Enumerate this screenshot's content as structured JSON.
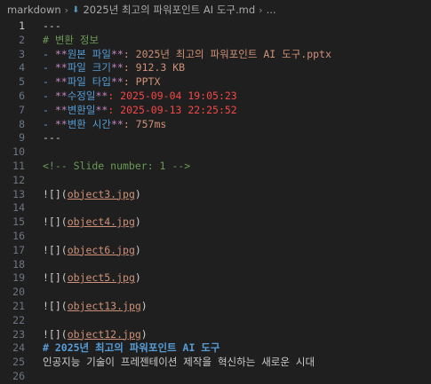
{
  "breadcrumb": {
    "folder": "markdown",
    "file": "2025년 최고의 파워포인트 AI 도구.md",
    "tail": "..."
  },
  "lines": [
    {
      "n": "1",
      "parts": [
        {
          "t": "---",
          "c": "c-default"
        }
      ]
    },
    {
      "n": "2",
      "parts": [
        {
          "t": "# 변환 정보",
          "c": "c-comment"
        }
      ]
    },
    {
      "n": "3",
      "parts": [
        {
          "t": "- ",
          "c": "c-bullet"
        },
        {
          "t": "**",
          "c": "c-bold"
        },
        {
          "t": "원본 파일",
          "c": "c-key"
        },
        {
          "t": "**",
          "c": "c-bold"
        },
        {
          "t": ": 2025년 최고의 파워포인트 AI 도구.pptx",
          "c": "c-val"
        }
      ]
    },
    {
      "n": "4",
      "parts": [
        {
          "t": "- ",
          "c": "c-bullet"
        },
        {
          "t": "**",
          "c": "c-bold"
        },
        {
          "t": "파일 크기",
          "c": "c-key"
        },
        {
          "t": "**",
          "c": "c-bold"
        },
        {
          "t": ": 912.3 KB",
          "c": "c-val"
        }
      ]
    },
    {
      "n": "5",
      "parts": [
        {
          "t": "- ",
          "c": "c-bullet"
        },
        {
          "t": "**",
          "c": "c-bold"
        },
        {
          "t": "파일 타입",
          "c": "c-key"
        },
        {
          "t": "**",
          "c": "c-bold"
        },
        {
          "t": ": PPTX",
          "c": "c-val"
        }
      ]
    },
    {
      "n": "6",
      "parts": [
        {
          "t": "- ",
          "c": "c-bullet"
        },
        {
          "t": "**",
          "c": "c-bold"
        },
        {
          "t": "수정일",
          "c": "c-key"
        },
        {
          "t": "**",
          "c": "c-bold"
        },
        {
          "t": ": 2025-09-04 19:05:23",
          "c": "c-red"
        }
      ]
    },
    {
      "n": "7",
      "parts": [
        {
          "t": "- ",
          "c": "c-bullet"
        },
        {
          "t": "**",
          "c": "c-bold"
        },
        {
          "t": "변환일",
          "c": "c-key"
        },
        {
          "t": "**",
          "c": "c-bold"
        },
        {
          "t": ": 2025-09-13 22:25:52",
          "c": "c-red"
        }
      ]
    },
    {
      "n": "8",
      "parts": [
        {
          "t": "- ",
          "c": "c-bullet"
        },
        {
          "t": "**",
          "c": "c-bold"
        },
        {
          "t": "변환 시간",
          "c": "c-key"
        },
        {
          "t": "**",
          "c": "c-bold"
        },
        {
          "t": ": 757ms",
          "c": "c-val"
        }
      ]
    },
    {
      "n": "9",
      "parts": [
        {
          "t": "---",
          "c": "c-default"
        }
      ]
    },
    {
      "n": "10",
      "parts": []
    },
    {
      "n": "11",
      "parts": [
        {
          "t": "<!-- Slide number: 1 -->",
          "c": "c-comment"
        }
      ]
    },
    {
      "n": "12",
      "parts": []
    },
    {
      "n": "13",
      "parts": [
        {
          "t": "![](",
          "c": "c-default"
        },
        {
          "t": "object3.jpg",
          "c": "c-link"
        },
        {
          "t": ")",
          "c": "c-default"
        }
      ]
    },
    {
      "n": "14",
      "parts": []
    },
    {
      "n": "15",
      "parts": [
        {
          "t": "![](",
          "c": "c-default"
        },
        {
          "t": "object4.jpg",
          "c": "c-link"
        },
        {
          "t": ")",
          "c": "c-default"
        }
      ]
    },
    {
      "n": "16",
      "parts": []
    },
    {
      "n": "17",
      "parts": [
        {
          "t": "![](",
          "c": "c-default"
        },
        {
          "t": "object6.jpg",
          "c": "c-link"
        },
        {
          "t": ")",
          "c": "c-default"
        }
      ]
    },
    {
      "n": "18",
      "parts": []
    },
    {
      "n": "19",
      "parts": [
        {
          "t": "![](",
          "c": "c-default"
        },
        {
          "t": "object5.jpg",
          "c": "c-link"
        },
        {
          "t": ")",
          "c": "c-default"
        }
      ]
    },
    {
      "n": "20",
      "parts": []
    },
    {
      "n": "21",
      "parts": [
        {
          "t": "![](",
          "c": "c-default"
        },
        {
          "t": "object13.jpg",
          "c": "c-link"
        },
        {
          "t": ")",
          "c": "c-default"
        }
      ]
    },
    {
      "n": "22",
      "parts": []
    },
    {
      "n": "23",
      "parts": [
        {
          "t": "![](",
          "c": "c-default"
        },
        {
          "t": "object12.jpg",
          "c": "c-link"
        },
        {
          "t": ")",
          "c": "c-default"
        }
      ]
    },
    {
      "n": "24",
      "parts": [
        {
          "t": "# 2025년 최고의 파워포인트 AI 도구",
          "c": "c-heading"
        }
      ]
    },
    {
      "n": "25",
      "parts": [
        {
          "t": "인공지능 기술이 프레젠테이션 제작을 혁신하는 새로운 시대",
          "c": "c-gray"
        }
      ]
    },
    {
      "n": "26",
      "parts": []
    }
  ]
}
